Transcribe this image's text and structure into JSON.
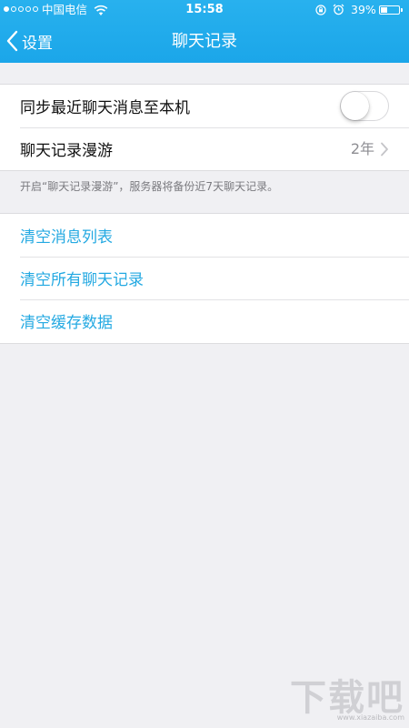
{
  "status_bar": {
    "carrier": "中国电信",
    "time": "15:58",
    "battery_percent": "39%",
    "battery_level": 0.39,
    "signal_strength": 1,
    "signal_total": 5
  },
  "nav": {
    "back_label": "设置",
    "title": "聊天记录"
  },
  "settings": {
    "sync": {
      "label": "同步最近聊天消息至本机",
      "enabled": false
    },
    "roaming": {
      "label": "聊天记录漫游",
      "value": "2年"
    },
    "footnote": "开启“聊天记录漫游”，服务器将备份近7天聊天记录。"
  },
  "actions": [
    {
      "label": "清空消息列表"
    },
    {
      "label": "清空所有聊天记录"
    },
    {
      "label": "清空缓存数据"
    }
  ],
  "watermark": {
    "text": "下载吧",
    "url": "www.xiazaiba.com"
  },
  "colors": {
    "nav_background": "#1ba6e9",
    "link": "#24a9e2",
    "page_background": "#f0f0f3"
  }
}
